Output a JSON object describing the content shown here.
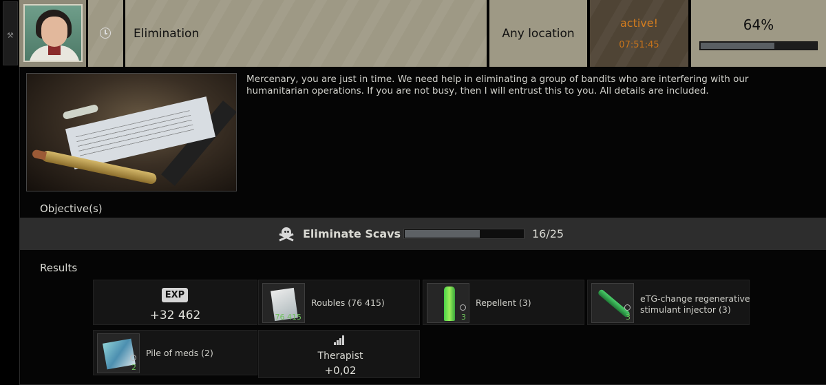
{
  "header": {
    "grip_icon": "wrench-icon",
    "avatar": "trader-portrait",
    "type_icon": "clock-icon",
    "quest_title": "Elimination",
    "location": "Any location",
    "status": "active!",
    "timer": "07:51:45",
    "progress_label": "64%",
    "progress_value": 0.64,
    "status_color": "#d57d1e"
  },
  "description": "Mercenary, you are just in time. We need help in eliminating a group of bandits who are interfering with our humanitarian operations. If you are not busy, then I will entrust this to you. All details are included.",
  "objectives": {
    "label": "Objective(s)",
    "items": [
      {
        "icon": "skull-icon",
        "text": "Eliminate Scavs",
        "current": 16,
        "total": 25,
        "progress_text": "16/25"
      }
    ]
  },
  "results": {
    "label": "Results",
    "exp": {
      "badge": "EXP",
      "value": "+32 462"
    },
    "items": [
      {
        "icon": "roubles-icon",
        "name": "Roubles (76 415)",
        "count": "76 415"
      },
      {
        "icon": "repellent-icon",
        "name": "Repellent (3)",
        "count": "3"
      },
      {
        "icon": "injector-icon",
        "name_line1": "eTG-change regenerative",
        "name_line2": "stimulant injector (3)",
        "count": "3"
      },
      {
        "icon": "meds-icon",
        "name": "Pile of meds (2)",
        "count": "2"
      }
    ],
    "trader": {
      "icon": "standing-icon",
      "name": "Therapist",
      "value": "+0,02"
    }
  }
}
